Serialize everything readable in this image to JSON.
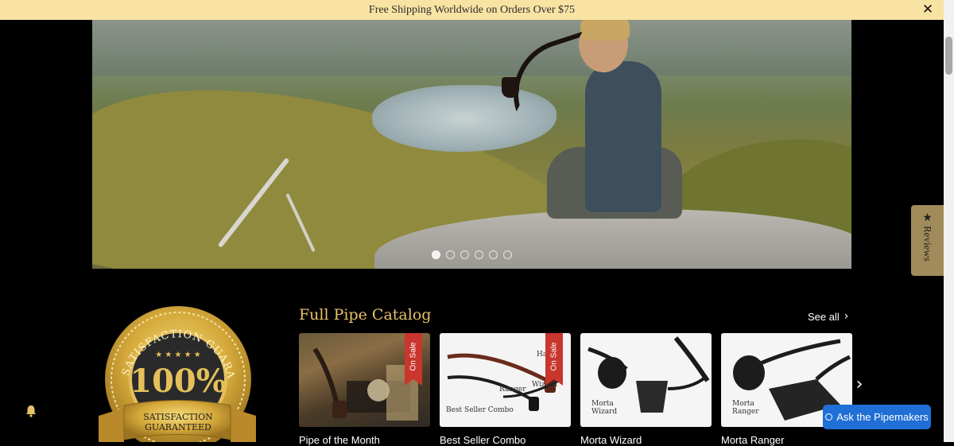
{
  "announcement": {
    "text": "Free Shipping Worldwide on Orders Over $75",
    "close_icon": "close-icon"
  },
  "hero": {
    "slide_count": 6,
    "active_slide": 1
  },
  "guarantee_seal": {
    "arc_text": "SATISFACTION GUARANTEED",
    "percent": "100%",
    "banner_line1": "SATISFACTION",
    "banner_line2": "GUARANTEED"
  },
  "catalog": {
    "title": "Full Pipe Catalog",
    "see_all_label": "See all",
    "products": [
      {
        "name": "Pipe of the Month",
        "badge": "On Sale",
        "image_text": ""
      },
      {
        "name": "Best Seller Combo",
        "badge": "On Sale",
        "image_text": "Best Seller Combo",
        "label_a": "Ranger",
        "label_b": "Wizard",
        "label_c": "Ha"
      },
      {
        "name": "Morta Wizard",
        "badge": "",
        "image_text": "Morta Wizard"
      },
      {
        "name": "Morta Ranger",
        "badge": "",
        "image_text": "Morta Ranger"
      }
    ]
  },
  "reviews_tab": {
    "label": "Reviews",
    "icon": "star-icon"
  },
  "chat": {
    "label": "Ask the Pipemakers"
  },
  "colors": {
    "announcement_bg": "#f8e3a3",
    "accent_gold": "#e7c16b",
    "ribbon_red": "#c8362d",
    "chat_blue": "#1f6fd6",
    "reviews_tab_bg": "#a18b5a"
  }
}
